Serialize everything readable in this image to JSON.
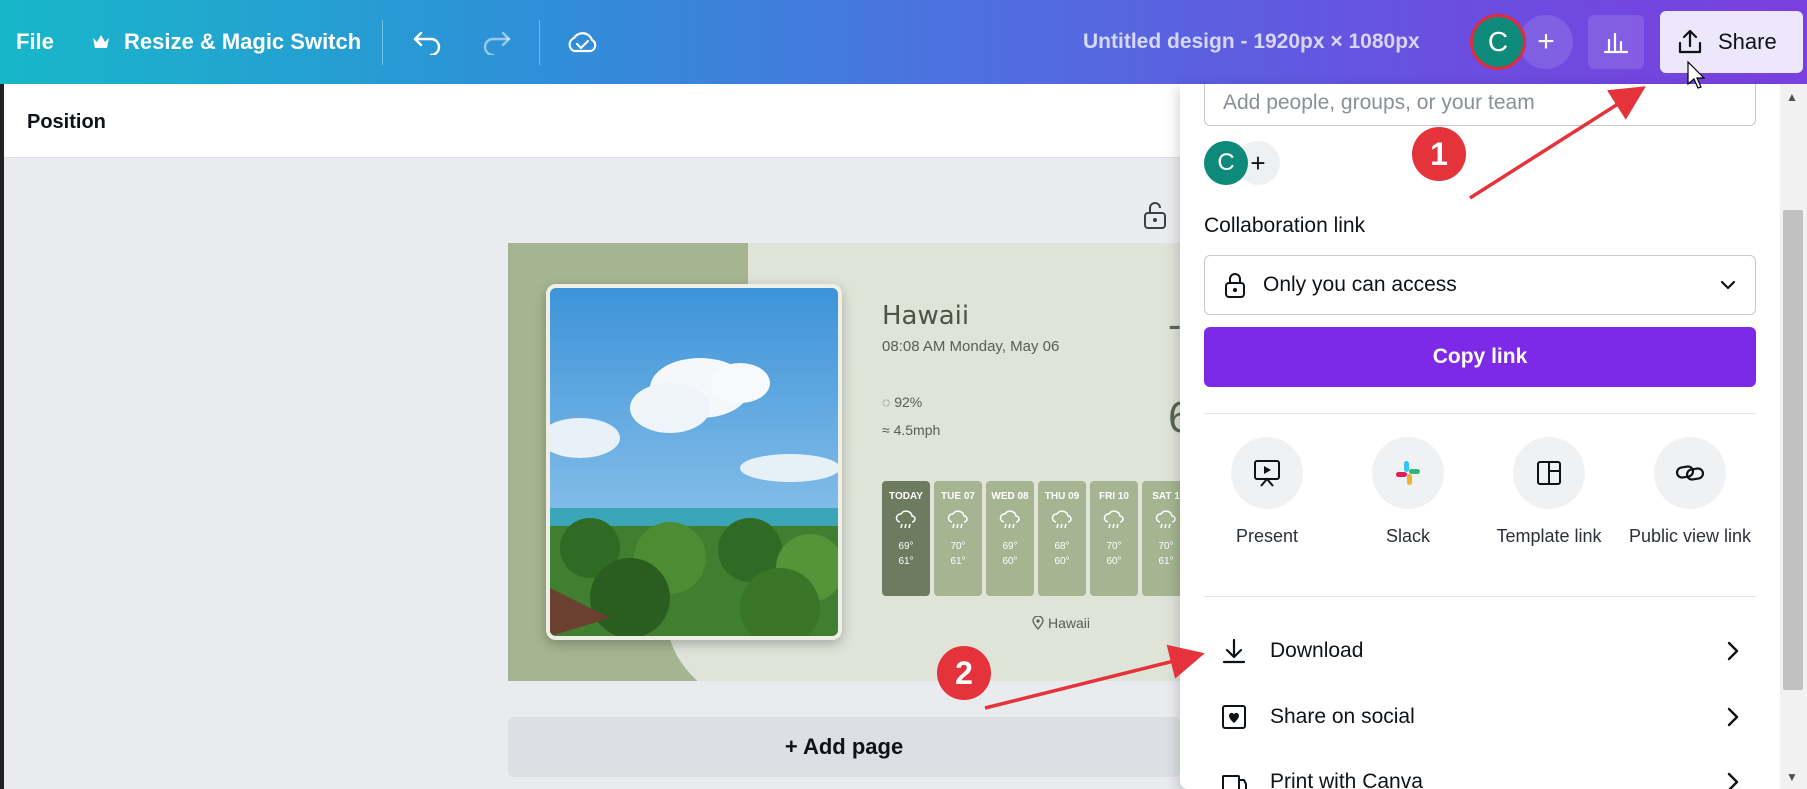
{
  "topbar": {
    "file_label": "File",
    "resize_label": "Resize & Magic Switch",
    "doc_title": "Untitled design - 1920px × 1080px",
    "avatar_initial": "C",
    "add_label": "+",
    "share_label": "Share"
  },
  "subbar": {
    "position_label": "Position"
  },
  "design": {
    "city": "Hawaii",
    "datetime": "08:08 AM  Monday, May 06",
    "humidity": "92%",
    "wind": "4.5mph",
    "big_temp": "6",
    "big_mark": "-",
    "location": "Hawaii",
    "days": [
      {
        "name": "TODAY",
        "hi": "69°",
        "lo": "61°"
      },
      {
        "name": "TUE 07",
        "hi": "70°",
        "lo": "61°"
      },
      {
        "name": "WED 08",
        "hi": "69°",
        "lo": "60°"
      },
      {
        "name": "THU 09",
        "hi": "68°",
        "lo": "60°"
      },
      {
        "name": "FRI 10",
        "hi": "70°",
        "lo": "60°"
      },
      {
        "name": "SAT 1",
        "hi": "70°",
        "lo": "61°"
      }
    ]
  },
  "canvas": {
    "add_page_label": "+ Add page"
  },
  "share_panel": {
    "people_placeholder": "Add people, groups, or your team",
    "avatar_initial": "C",
    "add_person": "+",
    "collab_label": "Collaboration link",
    "access_value": "Only you can access",
    "copy_link_label": "Copy link",
    "options": {
      "present": "Present",
      "slack": "Slack",
      "template_link": "Template link",
      "public_view_link": "Public view link"
    },
    "rows": {
      "download": "Download",
      "share_social": "Share on social",
      "print": "Print with Canva"
    },
    "accent_color": "#7d2ae8"
  },
  "annotations": {
    "badge1": "1",
    "badge2": "2",
    "arrow_color": "#e5333b"
  }
}
